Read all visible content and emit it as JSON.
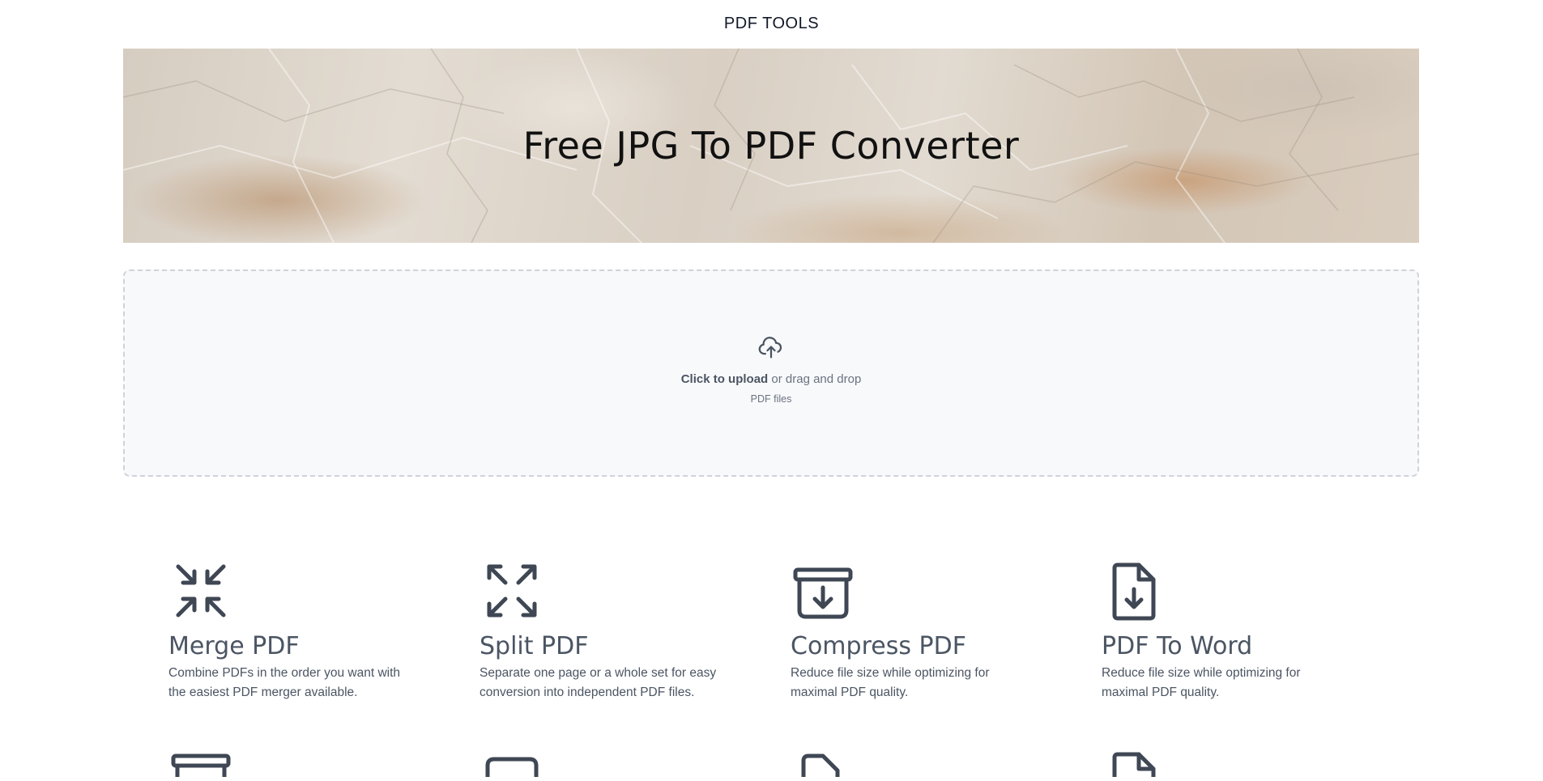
{
  "header": {
    "brand": "PDF TOOLS"
  },
  "hero": {
    "title": "Free JPG To PDF Converter"
  },
  "upload": {
    "click_label": "Click to upload",
    "drag_label": " or drag and drop",
    "hint": "PDF files",
    "icon": "cloud-upload-icon"
  },
  "tools": [
    {
      "name": "Merge PDF",
      "desc_line1": "Combine PDFs in the order you want with",
      "desc_line2": "the easiest PDF merger available.",
      "icon": "arrows-in-icon"
    },
    {
      "name": "Split PDF",
      "desc_line1": "Separate one page or a whole set for easy",
      "desc_line2": "conversion into independent PDF files.",
      "icon": "arrows-out-icon"
    },
    {
      "name": "Compress PDF",
      "desc_line1": "Reduce file size while optimizing for",
      "desc_line2": "maximal PDF quality.",
      "icon": "archive-down-icon"
    },
    {
      "name": "PDF To Word",
      "desc_line1": "Reduce file size while optimizing for",
      "desc_line2": "maximal PDF quality.",
      "icon": "file-download-icon"
    }
  ],
  "colors": {
    "icon": "#3f4754",
    "text": "#4b5563",
    "dropzone_bg": "#f8f9fb",
    "dropzone_border": "#cfd3d9"
  }
}
